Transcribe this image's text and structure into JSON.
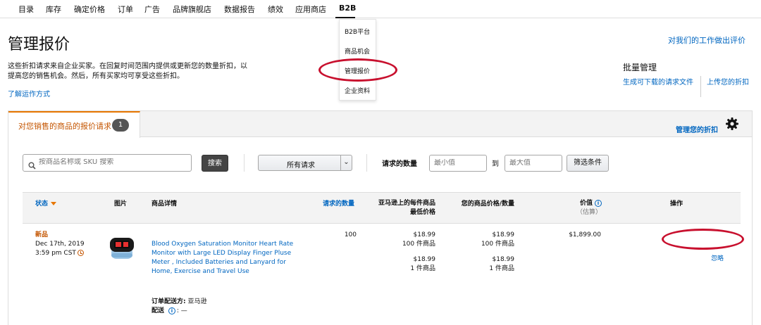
{
  "topnav": {
    "items": [
      "目录",
      "库存",
      "确定价格",
      "订单",
      "广告",
      "品牌旗舰店",
      "数据报告",
      "绩效",
      "应用商店",
      "B2B"
    ]
  },
  "b2b_menu": {
    "items": [
      "B2B平台",
      "商品机会",
      "管理报价",
      "企业资料"
    ]
  },
  "header": {
    "title": "管理报价",
    "description": "这些折扣请求来自企业买家。在回复时间范围内提供或更新您的数量折扣，以提高您的销售机会。然后，所有买家均可享受这些折扣。",
    "learn_link": "了解运作方式",
    "feedback_link": "对我们的工作做出评价",
    "bulk_title": "批量管理",
    "bulk_generate": "生成可下载的请求文件",
    "bulk_upload": "上传您的折扣"
  },
  "tab": {
    "label": "对您销售的商品的报价请求",
    "count": "1"
  },
  "icons": {
    "settings": "gear-icon",
    "search": "search-icon",
    "info": "info-icon",
    "clock": "clock-icon"
  },
  "filters": {
    "search_placeholder": "按商品名称或 SKU 搜索",
    "search_button": "搜索",
    "request_select": "所有请求",
    "qty_label": "请求的数量",
    "min_placeholder": "最小值",
    "to": "到",
    "max_placeholder": "最大值",
    "filter_button": "筛选条件"
  },
  "table": {
    "headers": {
      "status": "状态",
      "image": "图片",
      "details": "商品详情",
      "requested_qty": "请求的数量",
      "amazon_price_l1": "亚马逊上的每件商品",
      "amazon_price_l2": "最低价格",
      "your_price": "您的商品价格/数量",
      "value": "价值",
      "value_sub": "（估算）",
      "actions": "操作"
    },
    "rows": [
      {
        "status": "新品",
        "date": "Dec 17th, 2019",
        "time": "3:59 pm CST",
        "product_title": "Blood Oxygen Saturation Monitor Heart Rate Monitor with Large LED Display Finger Pluse Meter , Included Batteries and Lanyard for Home, Exercise and Travel Use",
        "ship_label": "订单配送方:",
        "ship_value": "亚马逊",
        "delivery_label": "配送",
        "delivery_value": "—",
        "qty": "100",
        "amazon_prices": [
          {
            "price": "$18.99",
            "qty": "100 件商品"
          },
          {
            "price": "$18.99",
            "qty": "1 件商品"
          }
        ],
        "your_prices": [
          {
            "price": "$18.99",
            "qty": "100 件商品"
          },
          {
            "price": "$18.99",
            "qty": "1 件商品"
          }
        ],
        "value": "$1,899.00",
        "action_primary": "管理您的折扣",
        "action_secondary": "忽略"
      }
    ]
  },
  "colors": {
    "link": "#0066c0",
    "accent_orange": "#e77600",
    "status_orange": "#c45500",
    "annotation_red": "#c8102e"
  }
}
